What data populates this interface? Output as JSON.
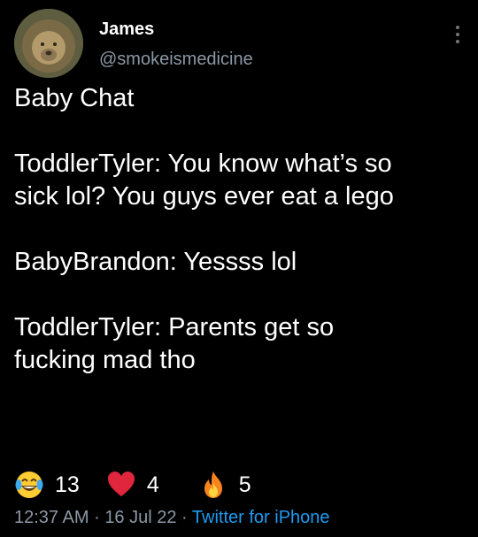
{
  "author": {
    "display_name": "James",
    "handle": "@smokeismedicine",
    "avatar_icon": "lion-avatar"
  },
  "tweet": {
    "lines": [
      "Baby Chat",
      "",
      "ToddlerTyler: You know what’s so",
      "sick lol? You guys ever eat a lego",
      "",
      "BabyBrandon: Yessss lol",
      "",
      "ToddlerTyler: Parents get so",
      "fucking mad tho"
    ]
  },
  "reactions": [
    {
      "icon": "laughing-tears-icon",
      "count": "13"
    },
    {
      "icon": "red-heart-icon",
      "count": "4"
    },
    {
      "icon": "fire-icon",
      "count": "5"
    }
  ],
  "meta": {
    "time": "12:37 AM",
    "separator": "·",
    "date": "16 Jul 22",
    "source": "Twitter for iPhone"
  },
  "colors": {
    "background": "#000000",
    "text": "#ffffff",
    "secondary": "#8b98a5",
    "link": "#1d9bf0"
  }
}
